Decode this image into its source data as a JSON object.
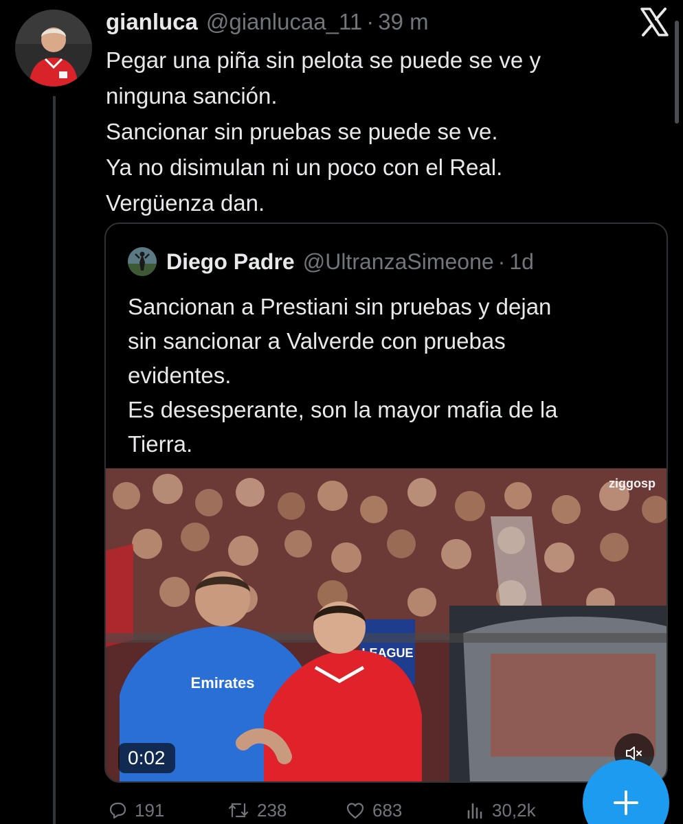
{
  "tweet": {
    "author_name": "gianluca",
    "author_handle": "@gianlucaa_11",
    "separator": "·",
    "time": "39 m",
    "avatar_icon": "profile-avatar",
    "lines": [
      "Pegar una piña sin pelota se puede se ve y",
      "ninguna sanción.",
      "Sancionar sin pruebas se puede se ve.",
      "Ya no disimulan ni un poco con el Real.",
      "Vergüenza dan."
    ]
  },
  "app": {
    "logo_icon": "x-logo-icon"
  },
  "quote": {
    "author_name": "Diego Padre",
    "author_handle": "@UltranzaSimeone",
    "separator": "·",
    "time": "1d",
    "lines": [
      "Sancionan a Prestiani sin pruebas y dejan",
      "sin sancionar a Valverde con pruebas",
      "evidentes.",
      "Es desesperante, son la mayor mafia de la",
      "Tierra."
    ],
    "video": {
      "duration": "0:02",
      "broadcaster_watermark": "ziggosp",
      "board_text": "LEAGUE",
      "jersey_sponsor": "Emirates",
      "mute_icon": "volume-muted-icon"
    }
  },
  "actions": {
    "replies": "191",
    "retweets": "238",
    "likes": "683",
    "views": "30,2k",
    "reply_icon": "reply-icon",
    "retweet_icon": "retweet-icon",
    "like_icon": "heart-icon",
    "views_icon": "views-icon"
  },
  "fab": {
    "icon": "plus-icon",
    "color": "#1d9bf0"
  },
  "colors": {
    "background": "#000000",
    "primary_text": "#e7e9ea",
    "secondary_text": "#71767b",
    "border": "#2f3336",
    "accent": "#1d9bf0"
  }
}
